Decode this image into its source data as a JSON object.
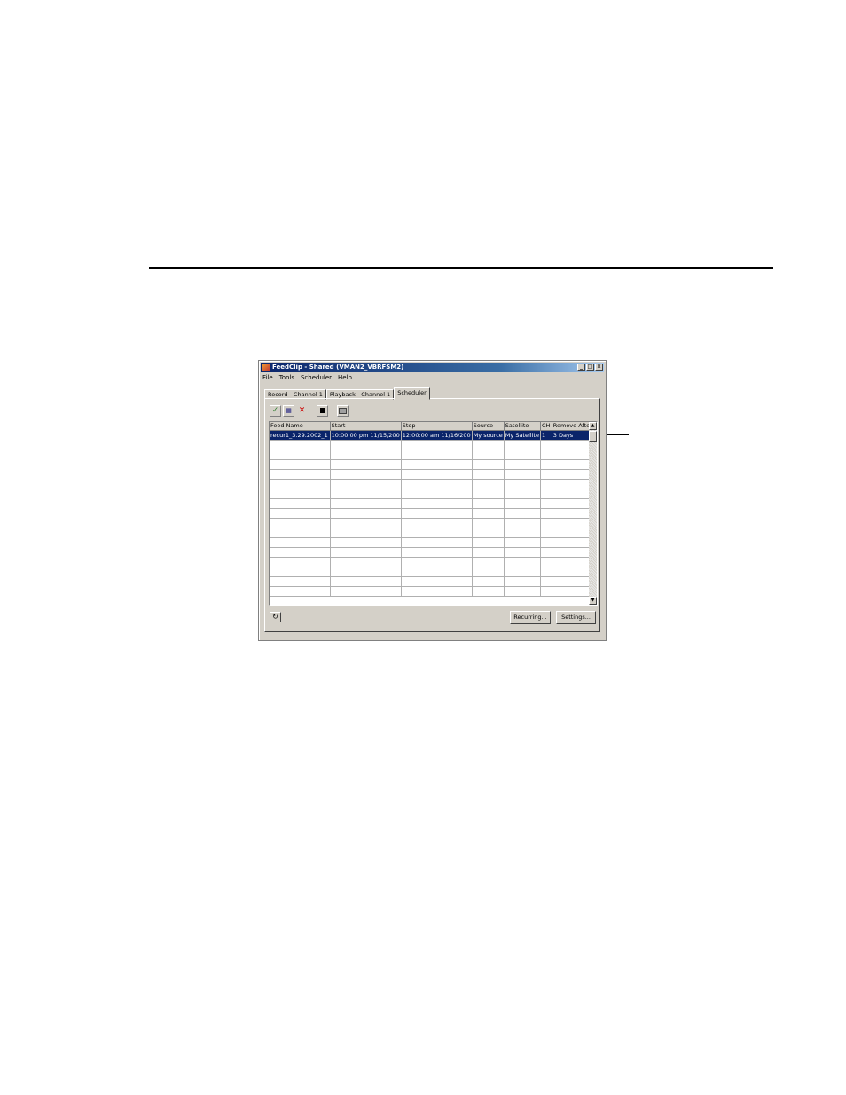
{
  "window": {
    "title": "FeedClip - Shared (VMAN2_VBRFSM2)",
    "controls": [
      "_",
      "□",
      "×"
    ]
  },
  "menu": [
    "File",
    "Tools",
    "Scheduler",
    "Help"
  ],
  "tabs": [
    {
      "label": "Record - Channel 1",
      "active": false
    },
    {
      "label": "Playback - Channel 1",
      "active": false
    },
    {
      "label": "Scheduler",
      "active": true
    }
  ],
  "toolbar": {
    "icons": [
      "new-schedule-icon",
      "edit-schedule-icon",
      "delete-icon",
      "stop-icon",
      "flag-icon"
    ]
  },
  "grid": {
    "columns": [
      "Feed Name",
      "Start",
      "Stop",
      "Source",
      "Satellite",
      "CH",
      "Remove After"
    ],
    "rows": [
      {
        "selected": true,
        "cells": [
          "recur1_3.29.2002_1",
          "10:00:00 pm  11/15/200",
          "12:00:00 am  11/16/200",
          "My source",
          "My Satellite",
          "1",
          "3 Days"
        ]
      }
    ],
    "empty_rows": 16
  },
  "buttons": {
    "recurring": "Recurring...",
    "settings": "Settings..."
  }
}
